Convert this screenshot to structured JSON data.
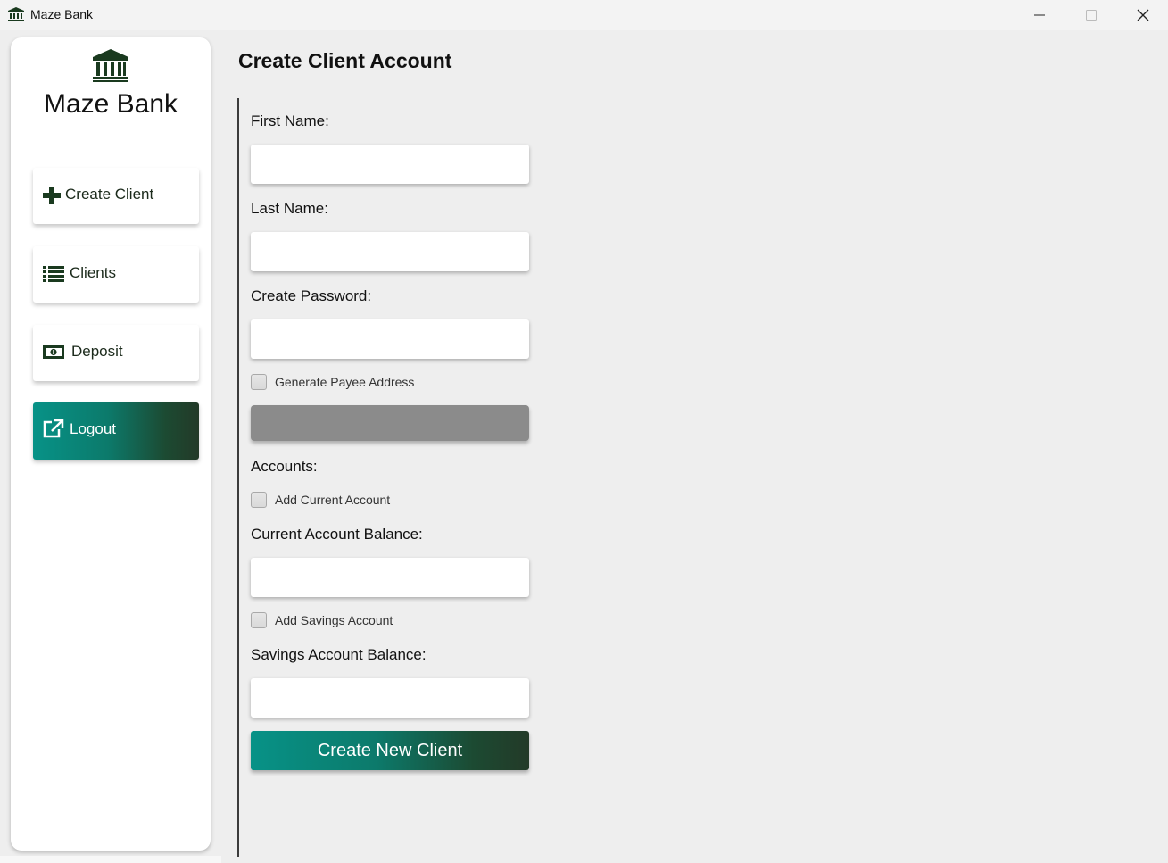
{
  "window": {
    "title": "Maze Bank",
    "icon": "bank-icon",
    "controls": [
      "minimize-icon",
      "maximize-icon",
      "close-icon"
    ]
  },
  "sidebar": {
    "logo_icon": "bank-icon",
    "logo_text": "Maze Bank",
    "items": [
      {
        "label": "Create Client",
        "icon": "plus-icon"
      },
      {
        "label": "Clients",
        "icon": "list-icon"
      },
      {
        "label": "Deposit",
        "icon": "money-icon"
      },
      {
        "label": "Logout",
        "icon": "external-link-icon"
      }
    ]
  },
  "main": {
    "title": "Create Client Account",
    "first_name_label": "First Name:",
    "first_name_value": "",
    "last_name_label": "Last Name:",
    "last_name_value": "",
    "password_label": "Create Password:",
    "password_value": "",
    "generate_payee_label": "Generate Payee Address",
    "generate_payee_checked": false,
    "payee_address_value": "",
    "accounts_label": "Accounts:",
    "add_current_label": "Add Current Account",
    "add_current_checked": false,
    "current_balance_label": "Current Account Balance:",
    "current_balance_value": "",
    "add_savings_label": "Add Savings Account",
    "add_savings_checked": false,
    "savings_balance_label": "Savings Account Balance:",
    "savings_balance_value": "",
    "submit_label": "Create New Client"
  },
  "colors": {
    "accent_start": "#079287",
    "accent_end": "#233a28",
    "icon_dark": "#1a3a1f",
    "background": "#eeeeee"
  }
}
